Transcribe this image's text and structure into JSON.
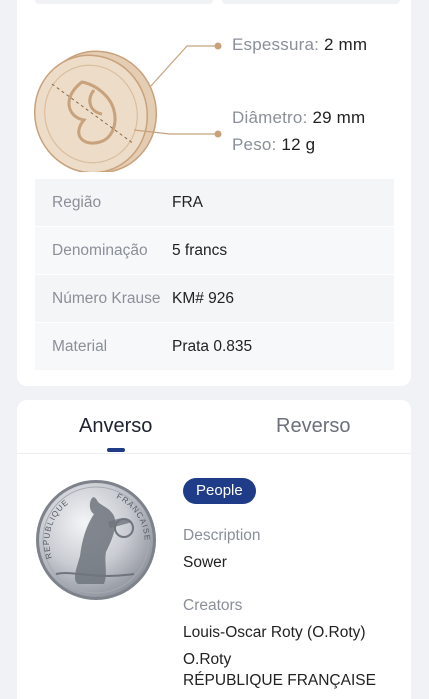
{
  "specs": {
    "thickness": {
      "label": "Espessura:",
      "value": "2 mm"
    },
    "diameter": {
      "label": "Diâmetro:",
      "value": "29 mm"
    },
    "weight": {
      "label": "Peso:",
      "value": "12 g"
    }
  },
  "details": [
    {
      "label": "Região",
      "value": "FRA"
    },
    {
      "label": "Denominação",
      "value": "5 francs"
    },
    {
      "label": "Número Krause",
      "value": "KM# 926"
    },
    {
      "label": "Material",
      "value": "Prata 0.835"
    }
  ],
  "tabs": {
    "obverse": "Anverso",
    "reverse": "Reverso",
    "active": "obverse"
  },
  "side": {
    "tag": "People",
    "description_label": "Description",
    "description": "Sower",
    "creators_label": "Creators",
    "creators": [
      "Louis-Oscar Roty (O.Roty)",
      "O.Roty"
    ],
    "lettering": "RÉPUBLIQUE FRANÇAISE",
    "coin_legend_left": "REPUBLIQUE",
    "coin_legend_right": "FRANCAISE"
  },
  "colors": {
    "accent": "#1f3c88",
    "coin_illus": "#eddcc7",
    "coin_stroke": "#c8a27c"
  }
}
